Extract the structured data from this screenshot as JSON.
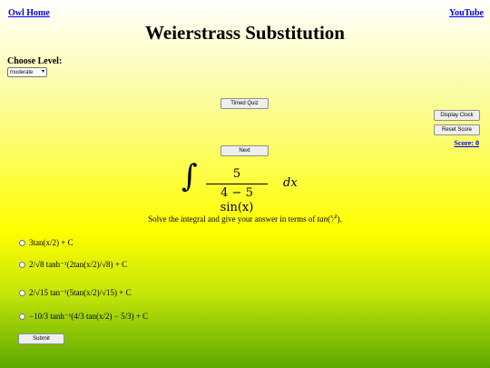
{
  "nav": {
    "home": "Owl Home",
    "youtube": "YouTube"
  },
  "title": "Weierstrass Substitution",
  "level": {
    "label": "Choose Level:",
    "selected": "moderate"
  },
  "buttons": {
    "timed_quiz": "Timed Quiz",
    "display_clock": "Display Clock",
    "reset_score": "Reset Score",
    "next": "Next",
    "submit": "Submit"
  },
  "score_text": "Score: 0",
  "integral": {
    "numerator": "5",
    "denominator": "4 − 5 sin(x)",
    "dx": "dx"
  },
  "instruction_html": "Solve the integral and give your answer in terms of <i>tan</i>(<span class=\"small\">x</span>⁄<span class=\"small\">2</span>).",
  "options": [
    "3tan(x/2) + C",
    "2/√8 tanh⁻¹(2tan(x/2)/√8) + C",
    "2/√15 tan⁻¹(5tan(x/2)/√15) + C",
    "−10/3 tanh⁻¹(4/3 tan(x/2) − 5/3) + C"
  ]
}
